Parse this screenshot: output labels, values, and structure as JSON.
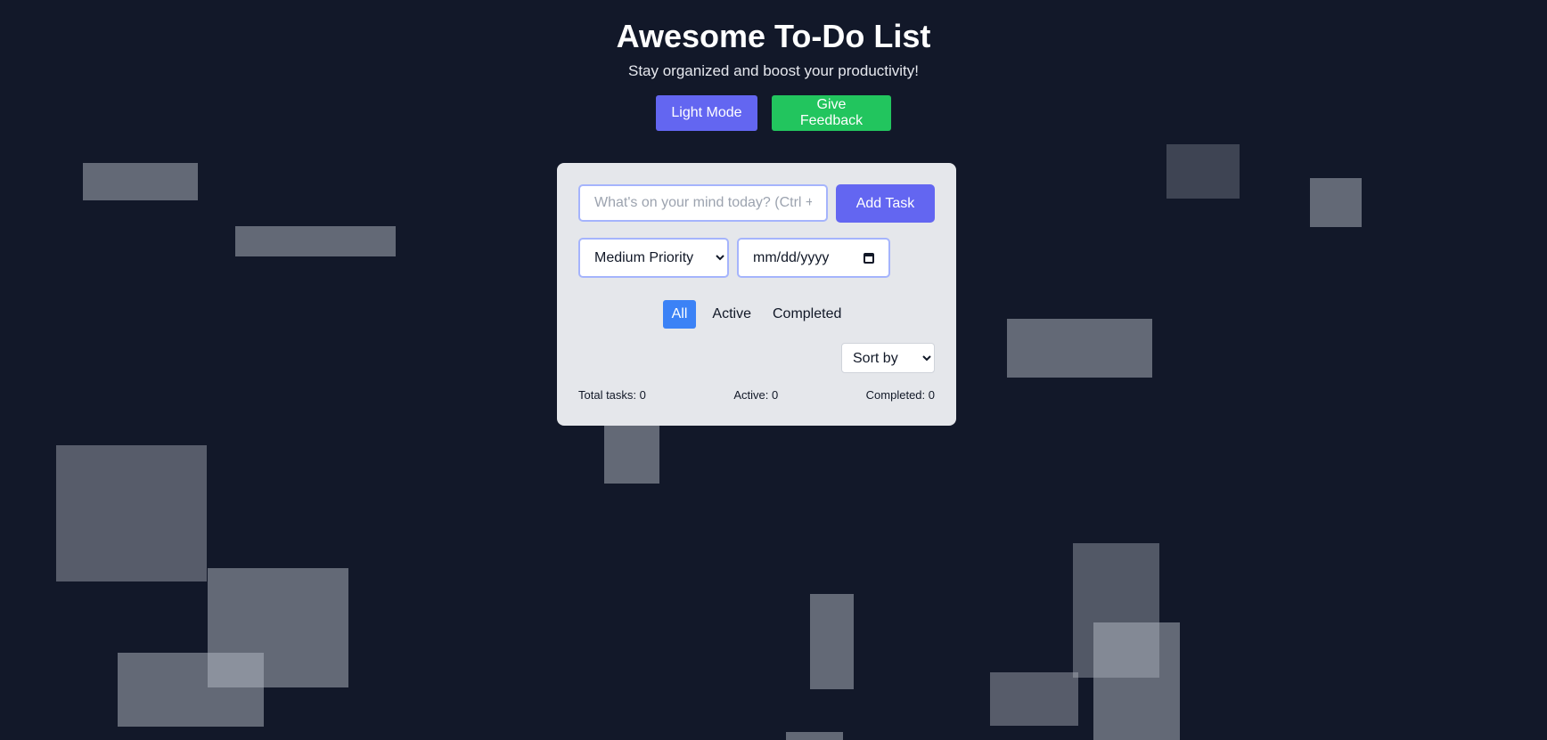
{
  "header": {
    "title": "Awesome To-Do List",
    "subtitle": "Stay organized and boost your productivity!",
    "theme_button": "Light Mode",
    "feedback_button": "Give Feedback"
  },
  "form": {
    "task_placeholder": "What's on your mind today? (Ctrl + Enter to add)",
    "add_button": "Add Task",
    "priority_selected": "Medium Priority",
    "date_placeholder": "mm/dd/yyyy"
  },
  "filters": {
    "all": "All",
    "active": "Active",
    "completed": "Completed",
    "selected": "All"
  },
  "sort": {
    "selected": "Sort by"
  },
  "stats": {
    "total": "Total tasks: 0",
    "active": "Active: 0",
    "completed": "Completed: 0"
  },
  "colors": {
    "background": "#121829",
    "primary": "#6366f1",
    "feedback": "#22c55e",
    "filter_active": "#3b82f6",
    "card": "#e5e7eb"
  },
  "icons": {
    "date_picker": "calendar-icon",
    "select_arrow": "chevron-down-icon"
  }
}
